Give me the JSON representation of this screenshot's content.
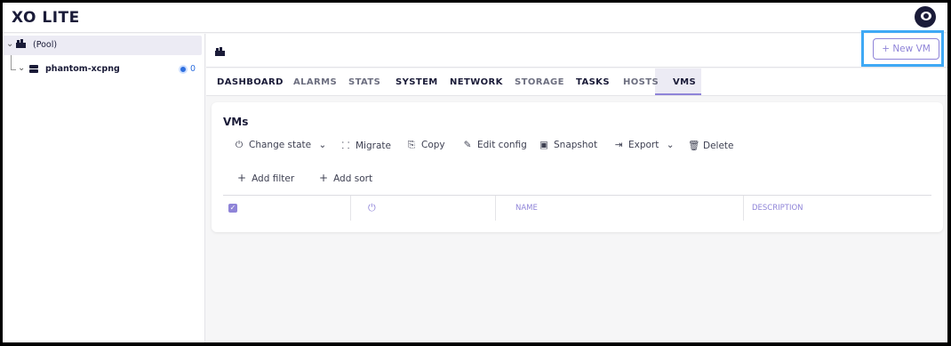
{
  "app": {
    "title": "XO LITE"
  },
  "sidebar": {
    "pool": {
      "label": "(Pool)"
    },
    "hosts": [
      {
        "label": "phantom-xcpng",
        "vm_count": "0"
      }
    ]
  },
  "toolbar": {
    "new_vm_label": "+ New VM"
  },
  "tabs": [
    "DASHBOARD",
    "ALARMS",
    "STATS",
    "SYSTEM",
    "NETWORK",
    "STORAGE",
    "TASKS",
    "HOSTS",
    "VMS"
  ],
  "active_tab": "VMS",
  "vms_card": {
    "title": "VMs",
    "actions": [
      {
        "label": "Change state",
        "icon": "power-icon"
      },
      {
        "label": "Migrate",
        "icon": "migrate-icon"
      },
      {
        "label": "Copy",
        "icon": "copy-icon"
      },
      {
        "label": "Edit config",
        "icon": "edit-icon"
      },
      {
        "label": "Snapshot",
        "icon": "camera-icon"
      },
      {
        "label": "Export",
        "icon": "export-icon"
      },
      {
        "label": "Delete",
        "icon": "trash-icon"
      }
    ],
    "add_filter": "Add filter",
    "add_sort": "Add sort",
    "columns": {
      "name": "NAME",
      "description": "DESCRIPTION"
    }
  },
  "colors": {
    "accent": "#8f84d8",
    "highlight": "#3fa9f5",
    "dark": "#1a1b38"
  }
}
